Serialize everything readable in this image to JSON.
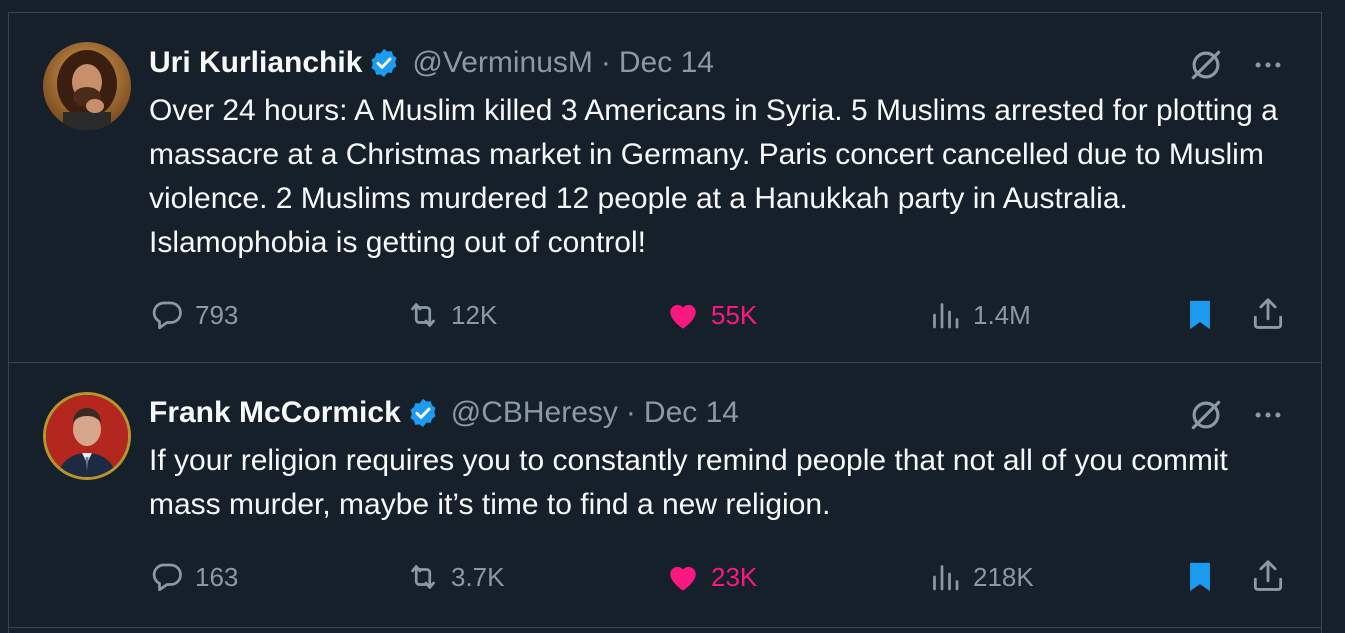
{
  "colors": {
    "background": "#15202b",
    "border": "#38444d",
    "muted": "#8b98a5",
    "like": "#f91880",
    "bookmark": "#1d9bf0",
    "verified": "#1d9bf0"
  },
  "tweets": [
    {
      "name": "Uri Kurlianchik",
      "handle": "@VerminusM",
      "separator": "·",
      "date": "Dec 14",
      "text": "Over 24 hours: A Muslim killed 3 Americans in Syria. 5 Muslims arrested for plotting a massacre at a Christmas market in Germany. Paris concert cancelled due to Muslim violence. 2 Muslims murdered 12 people at a Hanukkah party in Australia. Islamophobia is getting out of control!",
      "replies": "793",
      "reposts": "12K",
      "likes": "55K",
      "views": "1.4M",
      "liked": true,
      "bookmarked": true
    },
    {
      "name": "Frank McCormick",
      "handle": "@CBHeresy",
      "separator": "·",
      "date": "Dec 14",
      "text": "If your religion requires you to constantly remind people that not all of you commit mass murder, maybe it’s time to find a new religion.",
      "replies": "163",
      "reposts": "3.7K",
      "likes": "23K",
      "views": "218K",
      "liked": true,
      "bookmarked": true
    }
  ],
  "icons": [
    "verified-badge-icon",
    "grok-icon",
    "more-icon",
    "reply-icon",
    "retweet-icon",
    "heart-icon",
    "views-icon",
    "bookmark-icon",
    "share-icon"
  ]
}
